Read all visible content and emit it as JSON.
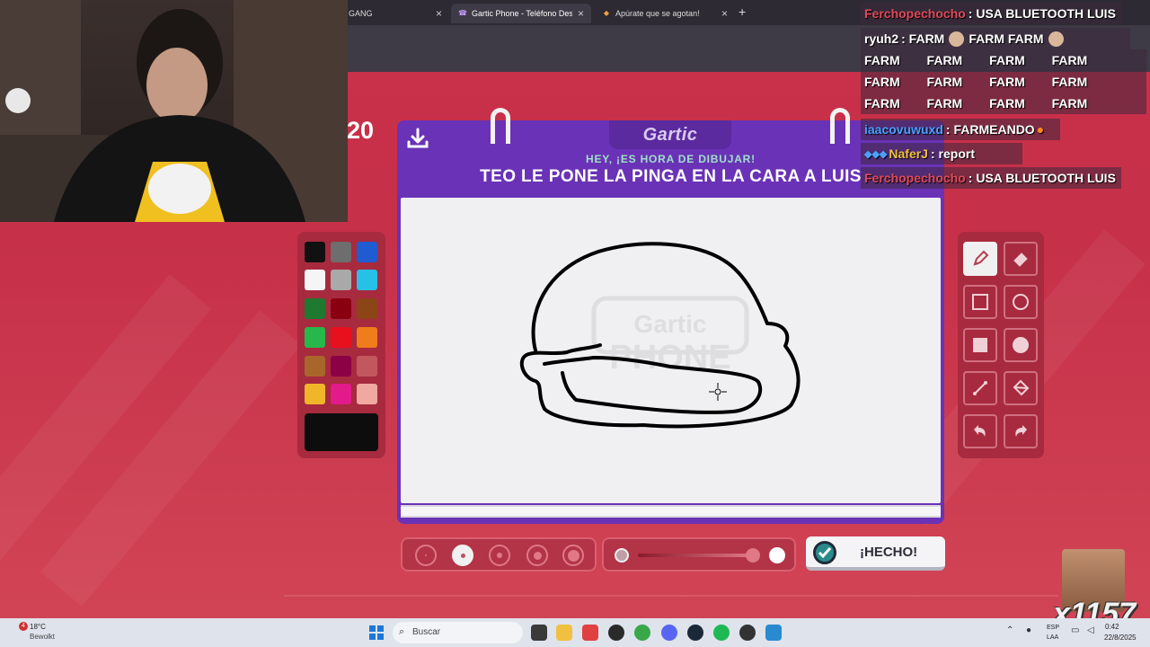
{
  "browser": {
    "tabs": [
      {
        "title": "GANG",
        "active": false
      },
      {
        "title": "Gartic Phone - Teléfono Descon",
        "active": true
      },
      {
        "title": "Apúrate que se agotan!",
        "active": false
      }
    ],
    "new_tab": "+"
  },
  "game": {
    "round_counter": "20",
    "logo": "Gartic",
    "hint": "HEY, ¡ES HORA DE DIBUJAR!",
    "prompt": "TEO LE PONE LA PINGA EN LA CARA A LUIS",
    "done_label": "¡HECHO!",
    "palette": [
      "#111111",
      "#6e6e6e",
      "#1f5bd1",
      "#f5f5f5",
      "#a9a9a9",
      "#27c0e6",
      "#1e7a2e",
      "#8a0010",
      "#8b4517",
      "#27b84a",
      "#e8101c",
      "#f07c1c",
      "#a8672a",
      "#8c0046",
      "#c2585e",
      "#f0b62a",
      "#e21a8a",
      "#f0a8a0"
    ],
    "current_color": "#0d0d0d",
    "tools": [
      "pencil",
      "eraser",
      "rectangle-outline",
      "circle-outline",
      "rectangle-filled",
      "circle-filled",
      "line",
      "bucket",
      "undo",
      "redo"
    ],
    "selected_tool": "pencil",
    "brush_sizes": [
      1,
      2,
      3,
      4,
      5
    ],
    "selected_size": 2,
    "canvas_watermark": [
      "Gartic",
      "PHONE"
    ]
  },
  "chat": [
    {
      "user": "Ferchopechocho",
      "user_color": "#e04a5a",
      "message": ": USA BLUETOOTH LUIS"
    },
    {
      "user": "ryuh2",
      "user_color": "#ffffff",
      "message": ": FARM",
      "emote_line": "FARM FARM"
    },
    {
      "user": "",
      "user_color": "#ffffff",
      "message": "FARM  FARM  FARM  FARM"
    },
    {
      "user": "",
      "user_color": "#ffffff",
      "message": "FARM  FARM  FARM  FARM"
    },
    {
      "user": "",
      "user_color": "#ffffff",
      "message": "FARM  FARM  FARM  FARM"
    },
    {
      "user": "iaacovuwuxd",
      "user_color": "#4aa0ff",
      "message": ": FARMEANDO"
    },
    {
      "user": "NaferJ",
      "user_color": "#f0c040",
      "message": ": report"
    },
    {
      "user": "Ferchopechocho",
      "user_color": "#e04a5a",
      "message": ": USA BLUETOOTH LUIS"
    }
  ],
  "taskbar": {
    "weather_temp": "18°C",
    "weather_desc": "Bewolkt",
    "weather_badge": "4",
    "search_placeholder": "Buscar",
    "lang_line1": "ESP",
    "lang_line2": "LAA",
    "clock_time": "0:42",
    "clock_date": "22/8/2025"
  },
  "overlay": {
    "multiplier": "x1157"
  }
}
